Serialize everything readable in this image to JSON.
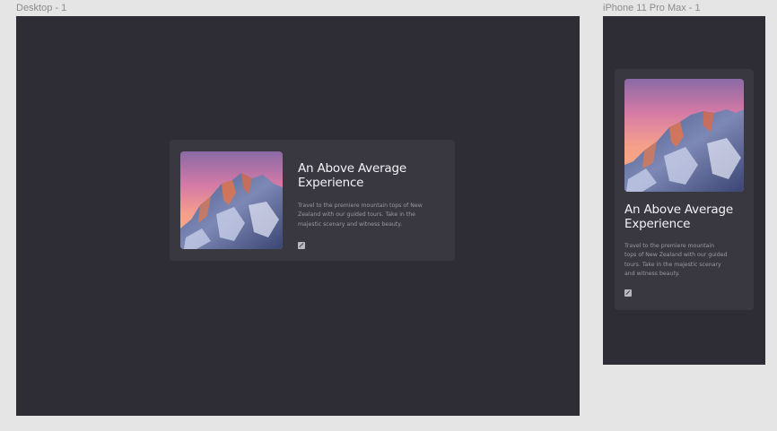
{
  "frames": {
    "desktop": {
      "label": "Desktop - 1"
    },
    "mobile": {
      "label": "iPhone 11 Pro Max - 1"
    }
  },
  "card": {
    "title_line1": "An Above Average",
    "title_line2": "Experience",
    "desc_desktop_lines": [
      "Travel to the premiere mountain tops of New",
      "Zealand with our guided tours. Take in the",
      "majestic scenary and witness beauty."
    ],
    "desc_mobile_lines": [
      "Travel to the premiere mountain",
      "tops of New Zealand with our guided",
      "tours. Take in the majestic scenary",
      "and witness beauty."
    ],
    "image": "mountain-sunset-photo",
    "link_icon": "external-link-icon"
  },
  "colors": {
    "canvas": "#e5e5e5",
    "frame_bg": "#2e2d35",
    "card_bg": "#393841",
    "title": "#f2f2f5",
    "desc": "#9a99a3"
  }
}
